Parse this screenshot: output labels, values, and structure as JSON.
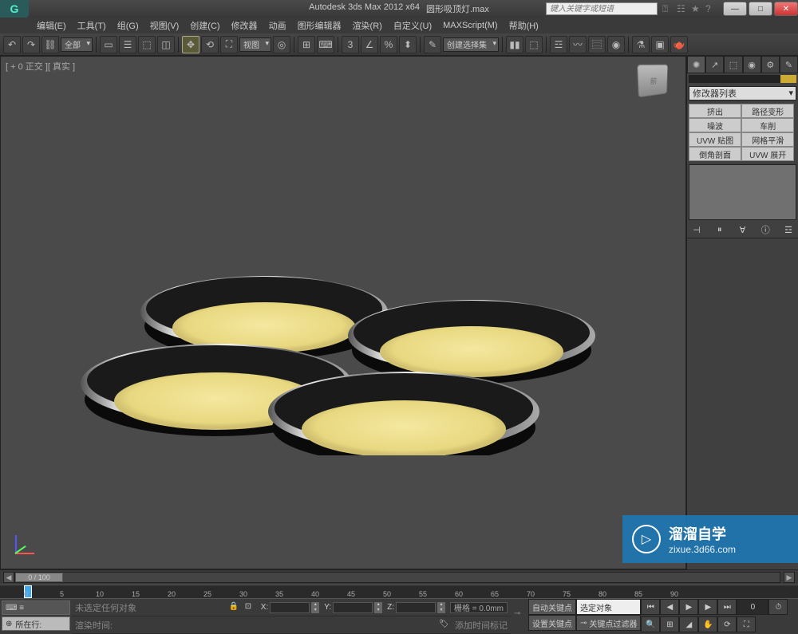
{
  "title": {
    "app": "Autodesk 3ds Max 2012 x64",
    "file": "圆形吸顶灯.max",
    "search_placeholder": "键入关键字或短语"
  },
  "menu": {
    "items": [
      "编辑(E)",
      "工具(T)",
      "组(G)",
      "视图(V)",
      "创建(C)",
      "修改器",
      "动画",
      "图形编辑器",
      "渲染(R)",
      "自定义(U)",
      "MAXScript(M)",
      "帮助(H)"
    ]
  },
  "toolbar": {
    "all_dropdown": "全部",
    "view_dropdown": "视图",
    "selset_dropdown": "创建选择集"
  },
  "viewport": {
    "label": "[ + 0 正交 ][ 真实 ]",
    "cube_face": "前"
  },
  "cmd_panel": {
    "tabs": [
      "✺",
      "↗",
      "⬚",
      "◉",
      "⚙",
      "✎"
    ],
    "modifier_list": "修改器列表",
    "buttons": [
      "挤出",
      "路径变形",
      "噪波",
      "车削",
      "UVW 贴图",
      "网格平滑",
      "倒角剖面",
      "UVW 展开"
    ]
  },
  "timeline": {
    "pos": "0 / 100",
    "ticks": [
      "0",
      "5",
      "10",
      "15",
      "20",
      "25",
      "30",
      "35",
      "40",
      "45",
      "50",
      "55",
      "60",
      "65",
      "70",
      "75",
      "80",
      "85",
      "90"
    ]
  },
  "status": {
    "current_line": "所在行:",
    "no_selection": "未选定任何对象",
    "x_label": "X:",
    "y_label": "Y:",
    "z_label": "Z:",
    "grid_label": "栅格 = 0.0mm",
    "render_time": "渲染时间:",
    "add_time_tag": "添加时间标记",
    "auto_key": "自动关键点",
    "set_key": "设置关键点",
    "sel_set_label": "选定对象",
    "key_filter": "关键点过滤器"
  },
  "watermark": {
    "cn": "溜溜自学",
    "en": "zixue.3d66.com"
  }
}
